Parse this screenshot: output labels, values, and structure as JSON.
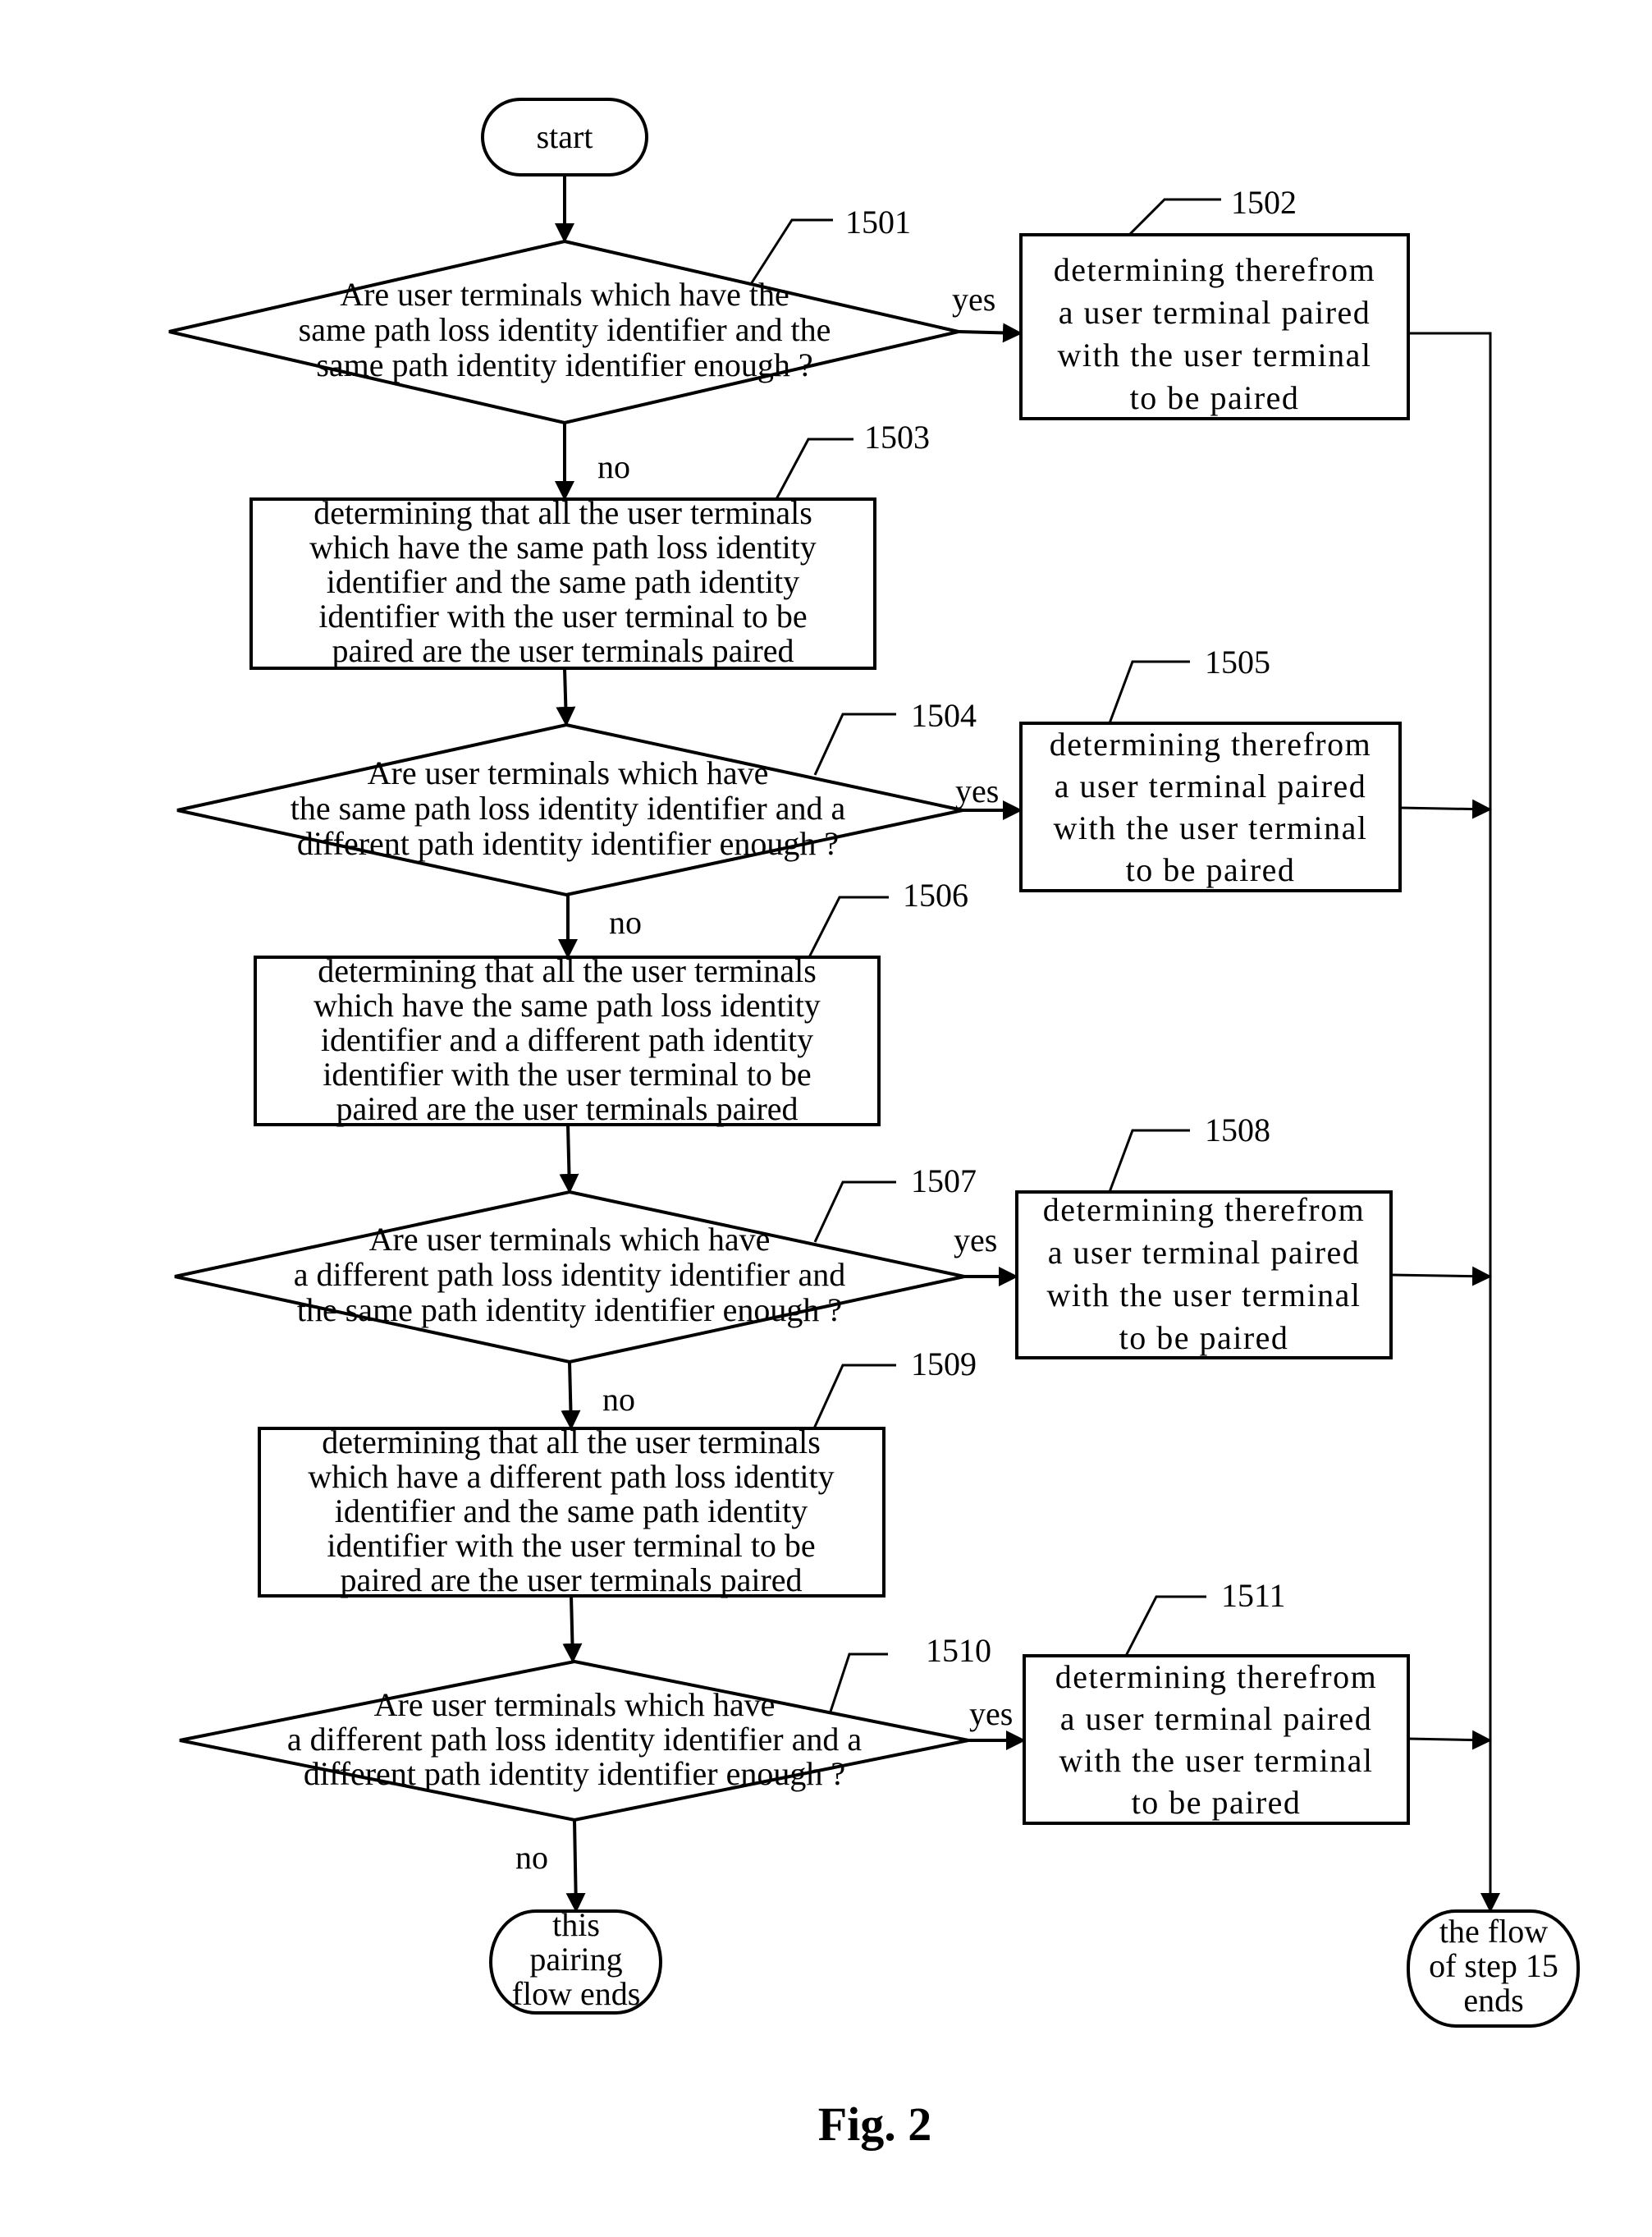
{
  "diagram": {
    "caption": "Fig. 2",
    "start": {
      "label": "start"
    },
    "decisions": [
      {
        "ref": "1501",
        "lines": [
          "Are user terminals which have the",
          "same path loss identity identifier and the",
          "same path identity identifier enough ?"
        ],
        "yes": "yes",
        "no": "no"
      },
      {
        "ref": "1504",
        "lines": [
          "Are user terminals which have",
          "the same path loss identity identifier and a",
          "different path identity identifier enough ?"
        ],
        "yes": "yes",
        "no": "no"
      },
      {
        "ref": "1507",
        "lines": [
          "Are user terminals which have",
          "a different path loss identity identifier and",
          "the same path identity identifier enough ?"
        ],
        "yes": "yes",
        "no": "no"
      },
      {
        "ref": "1510",
        "lines": [
          "Are user terminals which have",
          "a different path loss identity identifier and a",
          "different path identity identifier enough ?"
        ],
        "yes": "yes",
        "no": "no"
      }
    ],
    "fallback_steps": [
      {
        "ref": "1503",
        "lines": [
          "determining that all the user terminals",
          "which have the same path loss identity",
          "identifier and the same path identity",
          "identifier with the user terminal to be",
          "paired are the user terminals paired"
        ]
      },
      {
        "ref": "1506",
        "lines": [
          "determining that all the user terminals",
          "which have the same path loss identity",
          "identifier and a different path identity",
          "identifier with the user terminal to be",
          "paired are the user terminals paired"
        ]
      },
      {
        "ref": "1509",
        "lines": [
          "determining that all the user terminals",
          "which have a different path loss identity",
          "identifier and the same path identity",
          "identifier with the user terminal to be",
          "paired are the user terminals paired"
        ]
      }
    ],
    "select_steps": [
      {
        "ref": "1502",
        "lines": [
          "determining therefrom",
          "a user terminal paired",
          "with the user terminal",
          "to be paired"
        ]
      },
      {
        "ref": "1505",
        "lines": [
          "determining therefrom",
          "a user terminal paired",
          "with the user terminal",
          "to be paired"
        ]
      },
      {
        "ref": "1508",
        "lines": [
          "determining therefrom",
          "a user terminal paired",
          "with the user terminal",
          "to be paired"
        ]
      },
      {
        "ref": "1511",
        "lines": [
          "determining therefrom",
          "a user terminal paired",
          "with the user terminal",
          "to be paired"
        ]
      }
    ],
    "end_left": {
      "lines": [
        "this",
        "pairing",
        "flow ends"
      ]
    },
    "end_right": {
      "lines": [
        "the flow",
        "of step 15",
        "ends"
      ]
    }
  }
}
